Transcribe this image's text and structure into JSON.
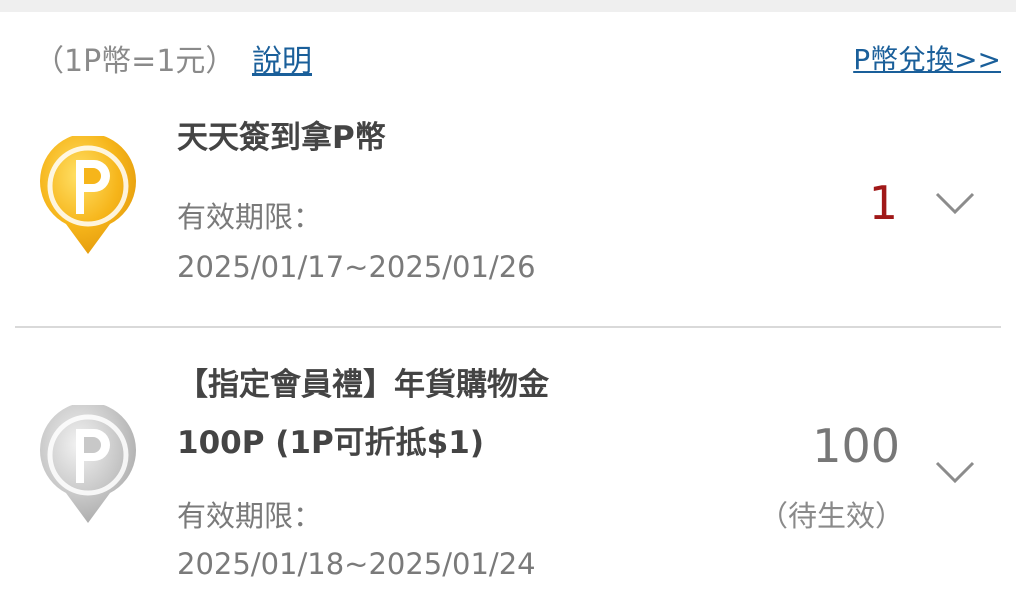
{
  "header": {
    "rate_text": "（1P幣=1元）",
    "explain_label": "說明",
    "exchange_label": "P幣兌換>>"
  },
  "items": [
    {
      "title": "天天簽到拿P幣",
      "validity_label": "有效期限：",
      "date_range": "2025/01/17~2025/01/26",
      "amount": "1",
      "coin_icon": "p-coin-gold-icon",
      "amount_color": "#a01818"
    },
    {
      "title": "【指定會員禮】年貨購物金",
      "subtitle": "100P (1P可折抵$1)",
      "validity_label": "有效期限：",
      "date_range": "2025/01/18~2025/01/24",
      "amount": "100",
      "status": "（待生效）",
      "coin_icon": "p-coin-gray-icon",
      "amount_color": "#777777"
    }
  ],
  "colors": {
    "link": "#1a5f9a",
    "gold": "#f6b51a",
    "gray_coin": "#c8c8c8"
  }
}
